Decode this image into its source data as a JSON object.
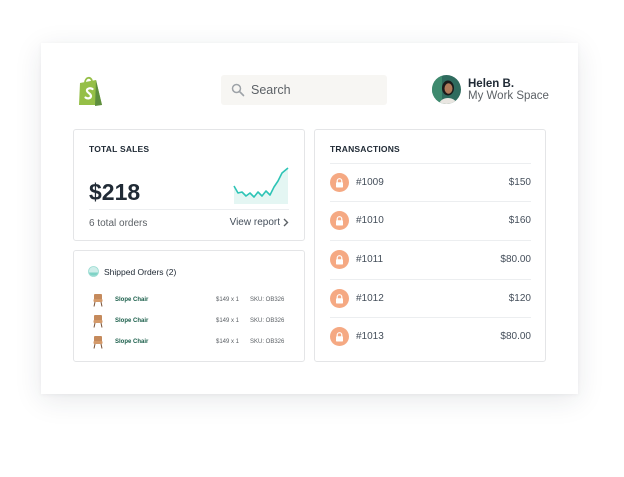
{
  "header": {
    "search": {
      "placeholder": "Search",
      "icon": "search-icon"
    },
    "user": {
      "name": "Helen B.",
      "workspace": "My Work Space"
    },
    "colors": {
      "brand": "#95bf47",
      "accent": "#2ec4b6",
      "transaction_icon": "#f5a983"
    }
  },
  "total_sales": {
    "title": "TOTAL SALES",
    "amount": "$218",
    "orders": "6 total orders",
    "view_report": "View report"
  },
  "shipped": {
    "title": "Shipped Orders (2)",
    "items": [
      {
        "name": "Slope Chair",
        "qty": "$149 x 1",
        "sku": "SKU: OB326"
      },
      {
        "name": "Slope Chair",
        "qty": "$149 x 1",
        "sku": "SKU: OB326"
      },
      {
        "name": "Slope Chair",
        "qty": "$149 x 1",
        "sku": "SKU: OB326"
      }
    ]
  },
  "transactions": {
    "title": "TRANSACTIONS",
    "items": [
      {
        "id": "#1009",
        "amount": "$150"
      },
      {
        "id": "#1010",
        "amount": "$160"
      },
      {
        "id": "#1011",
        "amount": "$80.00"
      },
      {
        "id": "#1012",
        "amount": "$120"
      },
      {
        "id": "#1013",
        "amount": "$80.00"
      }
    ]
  }
}
